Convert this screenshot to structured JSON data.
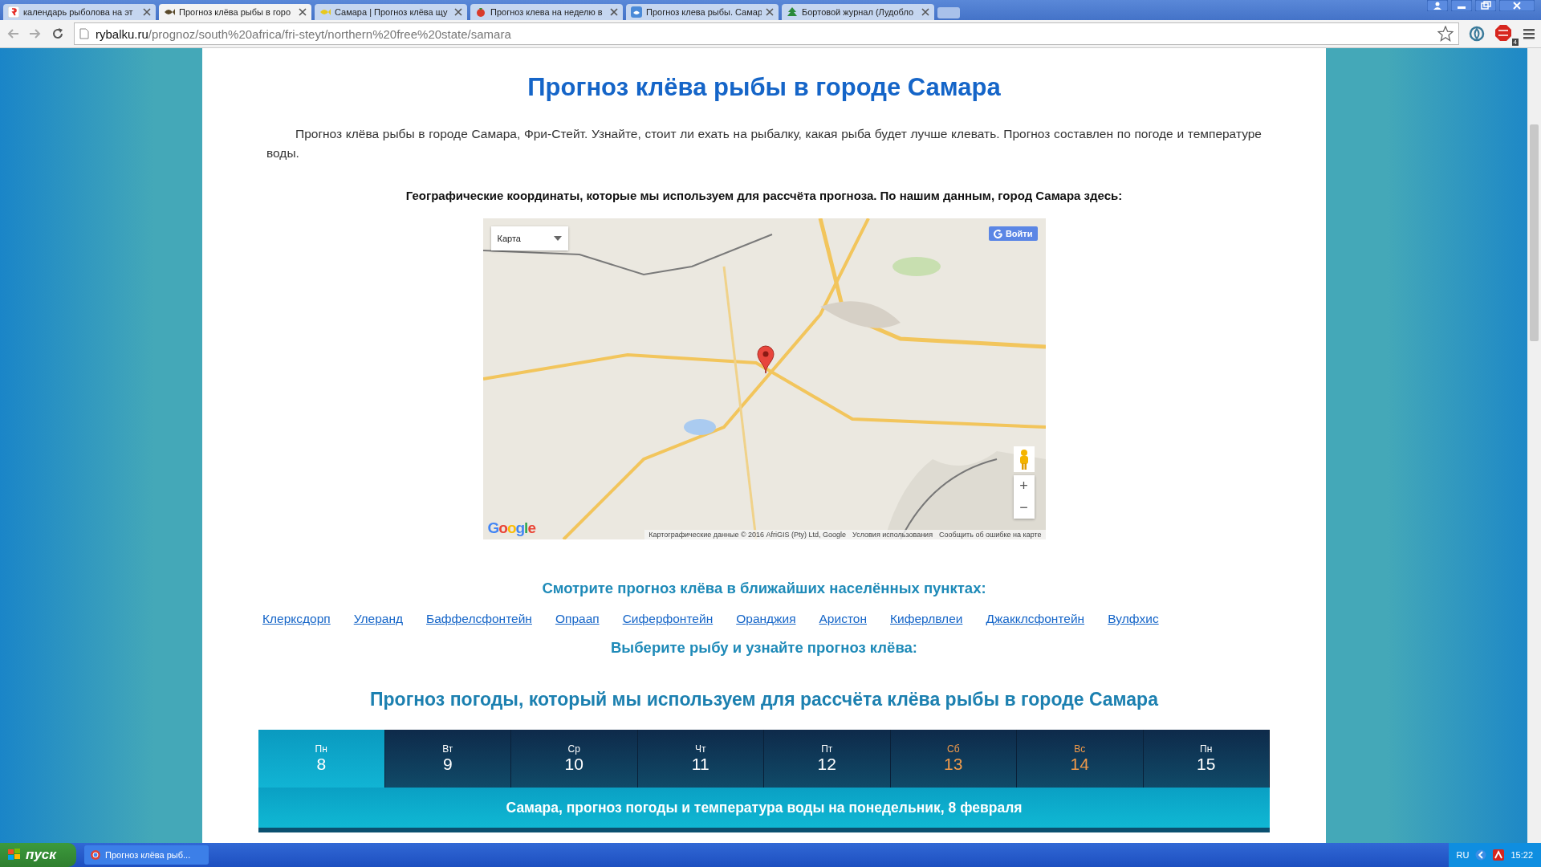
{
  "browser": {
    "tabs": [
      {
        "title": "календарь рыболова на эт",
        "selected": false
      },
      {
        "title": "Прогноз клёва рыбы в горо",
        "selected": true
      },
      {
        "title": "Самара | Прогноз клёва щу",
        "selected": false
      },
      {
        "title": "Прогноз клева на неделю в",
        "selected": false
      },
      {
        "title": "Прогноз клева рыбы. Самар",
        "selected": false
      },
      {
        "title": "Бортовой журнал (Лудобло",
        "selected": false
      }
    ],
    "address": {
      "host": "rybalku.ru",
      "path": "/prognoz/south%20africa/fri-steyt/northern%20free%20state/samara"
    },
    "extension_badge": "4"
  },
  "page": {
    "title": "Прогноз клёва рыбы в городе Самара",
    "intro": "Прогноз клёва рыбы в городе Самара, Фри-Стейт. Узнайте, стоит ли ехать на рыбалку, какая рыба будет лучше клевать. Прогноз составлен по погоде и температуре воды.",
    "coords_note": "Географические координаты, которые мы используем для рассчёта прогноза. По нашим данным, город Самара здесь:",
    "map": {
      "type_control": "Карта",
      "sign_in": "Войти",
      "zoom_in": "+",
      "zoom_out": "−",
      "logo": "Google",
      "attribution": [
        "Картографические данные © 2016 AfriGIS (Pty) Ltd, Google",
        "Условия использования",
        "Сообщить об ошибке на карте"
      ]
    },
    "nearby_heading": "Смотрите прогноз клёва в ближайших населённых пунктах:",
    "nearby_links": [
      "Клерксдорп",
      "Улеранд",
      "Баффелсфонтейн",
      "Опраап",
      "Сиферфонтейн",
      "Оранджия",
      "Аристон",
      "Киферлвлеи",
      "Джакклсфонтейн",
      "Вулфхис"
    ],
    "fish_heading": "Выберите рыбу и узнайте прогноз клёва:",
    "weather_heading": "Прогноз погоды, который мы используем для рассчёта клёва рыбы в городе Самара",
    "days": [
      {
        "weekday": "Пн",
        "date": "8",
        "selected": true,
        "weekend": false
      },
      {
        "weekday": "Вт",
        "date": "9",
        "selected": false,
        "weekend": false
      },
      {
        "weekday": "Ср",
        "date": "10",
        "selected": false,
        "weekend": false
      },
      {
        "weekday": "Чт",
        "date": "11",
        "selected": false,
        "weekend": false
      },
      {
        "weekday": "Пт",
        "date": "12",
        "selected": false,
        "weekend": false
      },
      {
        "weekday": "Сб",
        "date": "13",
        "selected": false,
        "weekend": true
      },
      {
        "weekday": "Вс",
        "date": "14",
        "selected": false,
        "weekend": true
      },
      {
        "weekday": "Пн",
        "date": "15",
        "selected": false,
        "weekend": false
      }
    ],
    "day_banner": "Самара, прогноз погоды и температура воды на понедельник, 8 февраля"
  },
  "taskbar": {
    "start": "пуск",
    "window": "Прогноз клёва рыб...",
    "language": "RU",
    "clock": "15:22"
  }
}
